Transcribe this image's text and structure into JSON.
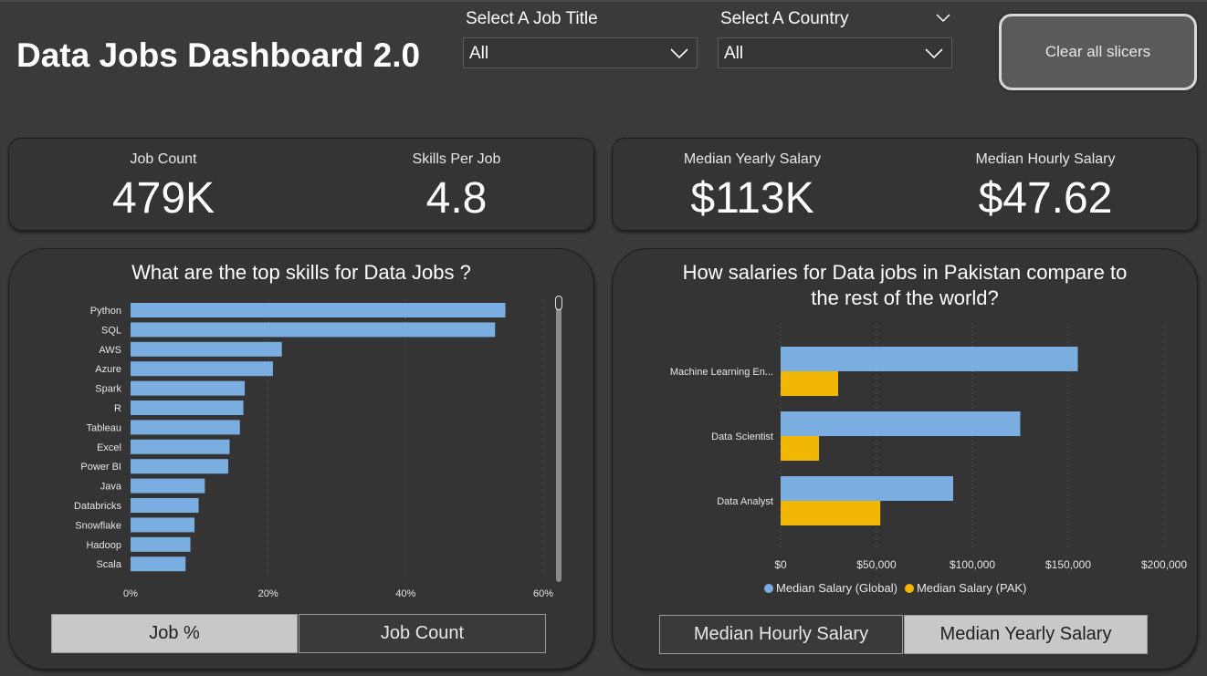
{
  "header": {
    "title": "Data Jobs Dashboard 2.0",
    "clear_button": "Clear all slicers"
  },
  "slicers": {
    "job_title": {
      "label": "Select A Job Title",
      "value": "All"
    },
    "country": {
      "label": "Select A Country",
      "value": "All"
    }
  },
  "kpis": [
    {
      "label": "Job Count",
      "value": "479K"
    },
    {
      "label": "Skills Per Job",
      "value": "4.8"
    },
    {
      "label": "Median Yearly Salary",
      "value": "$113K"
    },
    {
      "label": "Median Hourly Salary",
      "value": "$47.62"
    }
  ],
  "colors": {
    "global": "#7aaee0",
    "pak": "#f2b705",
    "background": "#3a3a3a",
    "card": "#343434"
  },
  "skills_panel": {
    "title": "What are the top skills for Data Jobs ?",
    "toggles": [
      {
        "label": "Job %",
        "active": true
      },
      {
        "label": "Job Count",
        "active": false
      }
    ]
  },
  "salary_panel": {
    "title_line1": "How salaries for Data jobs in Pakistan compare to",
    "title_line2": "the rest of the world?",
    "toggles": [
      {
        "label": "Median Hourly Salary",
        "active": false
      },
      {
        "label": "Median Yearly Salary",
        "active": true
      }
    ]
  },
  "chart_data": [
    {
      "type": "bar",
      "orientation": "horizontal",
      "categories": [
        "Python",
        "SQL",
        "AWS",
        "Azure",
        "Spark",
        "R",
        "Tableau",
        "Excel",
        "Power BI",
        "Java",
        "Databricks",
        "Snowflake",
        "Hadoop",
        "Scala"
      ],
      "values": [
        54.5,
        53,
        22,
        20.7,
        16.6,
        16.4,
        15.9,
        14.4,
        14.2,
        10.8,
        9.9,
        9.3,
        8.7,
        8.0
      ],
      "xticks": [
        "0%",
        "20%",
        "40%",
        "60%"
      ],
      "xlim": [
        0,
        60
      ],
      "grid": "vertical dotted"
    },
    {
      "type": "bar",
      "orientation": "horizontal",
      "categories": [
        "Machine Learning En...",
        "Data Scientist",
        "Data Analyst"
      ],
      "series": [
        {
          "name": "Median Salary (Global)",
          "values": [
            155000,
            125000,
            90000
          ]
        },
        {
          "name": "Median Salary (PAK)",
          "values": [
            30000,
            20000,
            52000
          ]
        }
      ],
      "xticks": [
        "$0",
        "$50,000",
        "$100,000",
        "$150,000",
        "$200,000"
      ],
      "xlim": [
        0,
        200000
      ],
      "legend": "bottom-center",
      "grid": "vertical dotted"
    }
  ]
}
